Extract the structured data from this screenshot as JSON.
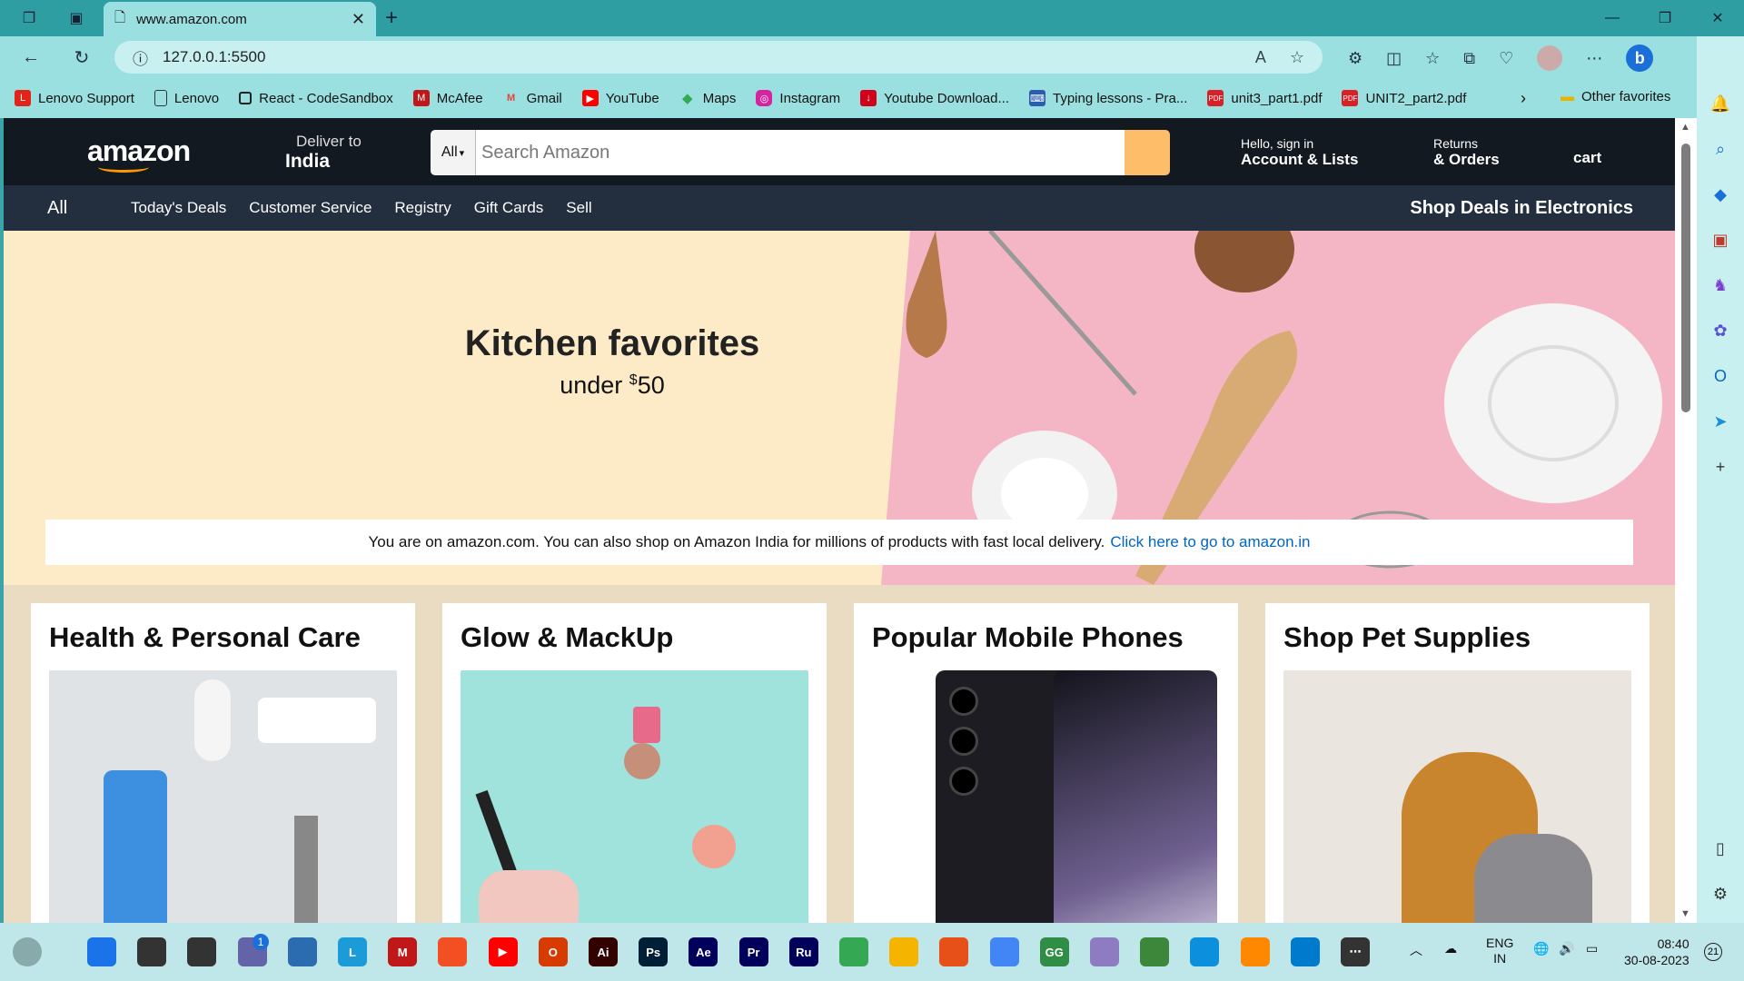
{
  "browser": {
    "tab_title": "www.amazon.com",
    "url": "127.0.0.1:5500",
    "favorites": [
      {
        "label": "Lenovo Support",
        "icon": "lenovo-icon",
        "color": "#e2231a"
      },
      {
        "label": "Lenovo",
        "icon": "page-icon",
        "color": "#666666"
      },
      {
        "label": "React - CodeSandbox",
        "icon": "codesandbox-icon",
        "color": "#222222"
      },
      {
        "label": "McAfee",
        "icon": "mcafee-icon",
        "color": "#c01818"
      },
      {
        "label": "Gmail",
        "icon": "gmail-icon",
        "color": "#ea4335"
      },
      {
        "label": "YouTube",
        "icon": "youtube-icon",
        "color": "#ff0000"
      },
      {
        "label": "Maps",
        "icon": "maps-icon",
        "color": "#34a853"
      },
      {
        "label": "Instagram",
        "icon": "instagram-icon",
        "color": "#d6249f"
      },
      {
        "label": "Youtube Download...",
        "icon": "download-icon",
        "color": "#d0021b"
      },
      {
        "label": "Typing lessons - Pra...",
        "icon": "typing-icon",
        "color": "#2a5db0"
      },
      {
        "label": "unit3_part1.pdf",
        "icon": "pdf-icon",
        "color": "#d92027"
      },
      {
        "label": "UNIT2_part2.pdf",
        "icon": "pdf-icon",
        "color": "#d92027"
      }
    ],
    "other_favorites": "Other favorites"
  },
  "amazon": {
    "logo": "amazon",
    "deliver_label": "Deliver to",
    "deliver_value": "India",
    "search_category": "All",
    "search_placeholder": "Search Amazon",
    "account_line1": "Hello, sign in",
    "account_line2": "Account & Lists",
    "returns_line1": "Returns",
    "returns_line2": "& Orders",
    "cart": "cart",
    "nav_all": "All",
    "nav_links": [
      "Today's Deals",
      "Customer Service",
      "Registry",
      "Gift Cards",
      "Sell"
    ],
    "nav_deals": "Shop Deals in Electronics",
    "hero_title": "Kitchen favorites",
    "hero_sub_prefix": "under ",
    "hero_sub_currency": "$",
    "hero_sub_amount": "50",
    "notice_text": "You are on amazon.com. You can also shop on Amazon India for millions of products with fast local delivery.",
    "notice_link": "Click here to go to amazon.in",
    "cards": [
      {
        "title": "Health & Personal Care",
        "color": "#dfe3e6"
      },
      {
        "title": "Glow & MackUp",
        "color": "#9fe3dc"
      },
      {
        "title": "Popular Mobile Phones",
        "color": "#1c1c22"
      },
      {
        "title": "Shop Pet Supplies",
        "color": "#c9a06a"
      }
    ]
  },
  "taskbar": {
    "chat_badge": "1",
    "lang_line1": "ENG",
    "lang_line2": "IN",
    "time": "08:40",
    "date": "30-08-2023",
    "notif_count": "21",
    "apps": [
      {
        "name": "start-icon",
        "label": "",
        "color": "#1a73e8"
      },
      {
        "name": "search-icon",
        "label": "",
        "color": "#333333"
      },
      {
        "name": "task-view-icon",
        "label": "",
        "color": "#333333"
      },
      {
        "name": "chat-icon",
        "label": "",
        "color": "#6264a7"
      },
      {
        "name": "store-icon",
        "label": "",
        "color": "#2b6cb0"
      },
      {
        "name": "lenovo-vantage-icon",
        "label": "L",
        "color": "#1b9bd7"
      },
      {
        "name": "mcafee-icon",
        "label": "M",
        "color": "#c01818"
      },
      {
        "name": "office-grid-icon",
        "label": "",
        "color": "#f25022"
      },
      {
        "name": "youtube-icon",
        "label": "▶",
        "color": "#ff0000"
      },
      {
        "name": "office-icon",
        "label": "O",
        "color": "#d83b01"
      },
      {
        "name": "illustrator-icon",
        "label": "Ai",
        "color": "#330000"
      },
      {
        "name": "photoshop-icon",
        "label": "Ps",
        "color": "#001e36"
      },
      {
        "name": "after-effects-icon",
        "label": "Ae",
        "color": "#00005b"
      },
      {
        "name": "premiere-icon",
        "label": "Pr",
        "color": "#00005b"
      },
      {
        "name": "rush-icon",
        "label": "Ru",
        "color": "#00005b"
      },
      {
        "name": "drive-icon",
        "label": "",
        "color": "#34a853"
      },
      {
        "name": "file-explorer-icon",
        "label": "",
        "color": "#f4b400"
      },
      {
        "name": "app-icon",
        "label": "",
        "color": "#e8501a"
      },
      {
        "name": "chrome-icon",
        "label": "",
        "color": "#4285f4"
      },
      {
        "name": "gfg-icon",
        "label": "GG",
        "color": "#2f8d46"
      },
      {
        "name": "avatar-app-icon",
        "label": "",
        "color": "#8e7cc3"
      },
      {
        "name": "node-icon",
        "label": "",
        "color": "#3c873a"
      },
      {
        "name": "edge-icon",
        "label": "",
        "color": "#0c8fdc"
      },
      {
        "name": "vlc-icon",
        "label": "",
        "color": "#ff8800"
      },
      {
        "name": "vscode-icon",
        "label": "",
        "color": "#007acc"
      },
      {
        "name": "more-icon",
        "label": "⋯",
        "color": "#333333"
      }
    ]
  }
}
